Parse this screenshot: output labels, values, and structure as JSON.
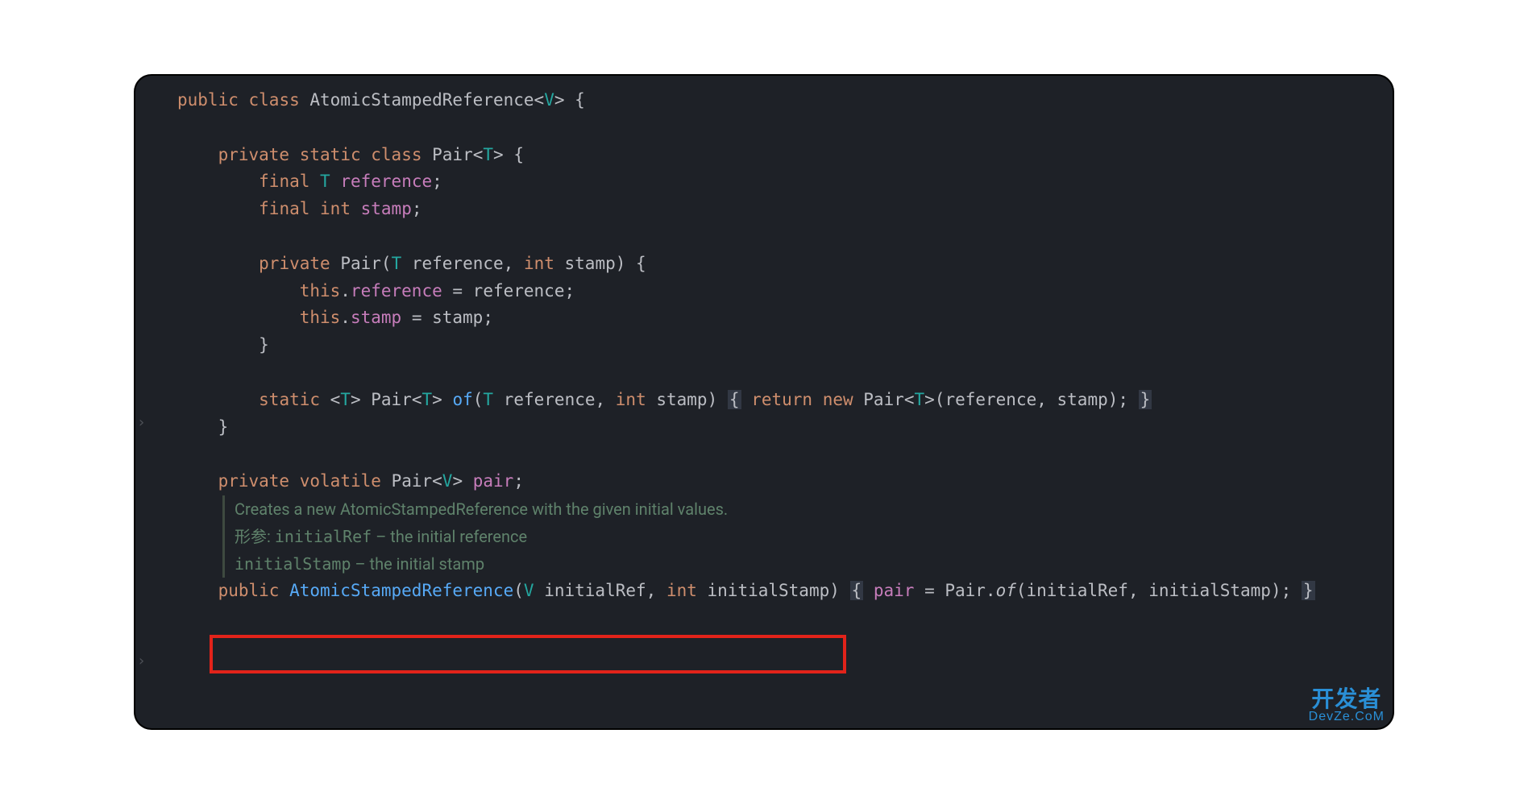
{
  "code": {
    "l1_public": "public",
    "l1_class": "class",
    "l1_name": "AtomicStampedReference",
    "l1_open": "<",
    "l1_v": "V",
    "l1_close": "> {",
    "l3_private": "private",
    "l3_static": "static",
    "l3_class": "class",
    "l3_name": "Pair",
    "l3_open": "<",
    "l3_t": "T",
    "l3_close": "> {",
    "l4_final": "final",
    "l4_t": "T",
    "l4_ref": "reference",
    "l4_semi": ";",
    "l5_final": "final",
    "l5_int": "int",
    "l5_stamp": "stamp",
    "l5_semi": ";",
    "l7_private": "private",
    "l7_pair": "Pair",
    "l7_open": "(",
    "l7_t": "T",
    "l7_p1": " reference, ",
    "l7_int": "int",
    "l7_p2": " stamp) {",
    "l8_this": "this",
    "l8_dot": ".",
    "l8_ref": "reference",
    "l8_eq": " = reference;",
    "l9_this": "this",
    "l9_dot": ".",
    "l9_stamp": "stamp",
    "l9_eq": " = stamp;",
    "l10_close": "}",
    "l12_static": "static",
    "l12_open1": "<",
    "l12_t1": "T",
    "l12_close1": "> Pair<",
    "l12_t2": "T",
    "l12_close2": "> ",
    "l12_of": "of",
    "l12_paren": "(",
    "l12_t3": "T",
    "l12_p1": " reference, ",
    "l12_int": "int",
    "l12_p2": " stamp) ",
    "l12_b1": "{",
    "l12_sp1": " ",
    "l12_return": "return",
    "l12_sp2": " ",
    "l12_new": "new",
    "l12_sp3": " Pair<",
    "l12_t4": "T",
    "l12_tail": ">(reference, stamp); ",
    "l12_b2": "}",
    "l13_close": "}",
    "l15_private": "private",
    "l15_volatile": "volatile",
    "l15_type": "Pair<",
    "l15_v": "V",
    "l15_close": "> ",
    "l15_pair": "pair",
    "l15_semi": ";",
    "l20_public": "public",
    "l20_name": "AtomicStampedReference",
    "l20_open": "(",
    "l20_v": "V",
    "l20_p1": " initialRef, ",
    "l20_int": "int",
    "l20_p2": " initialStamp) ",
    "l20_b1": "{",
    "l20_sp": " ",
    "l20_pair": "pair",
    "l20_eq": " = Pair.",
    "l20_of": "of",
    "l20_tail": "(initialRef, initialStamp); ",
    "l20_b2": "}"
  },
  "doc": {
    "line1": "Creates a new AtomicStampedReference with the given initial values.",
    "params_label": "形参:",
    "p1_name": "initialRef",
    "p1_desc": " – the initial reference",
    "p2_indent": "      ",
    "p2_name": "initialStamp",
    "p2_desc": " – the initial stamp"
  },
  "gutter": {
    "mark": "›"
  },
  "watermark": {
    "title": "开发者",
    "url": "DevZe.CoM"
  }
}
